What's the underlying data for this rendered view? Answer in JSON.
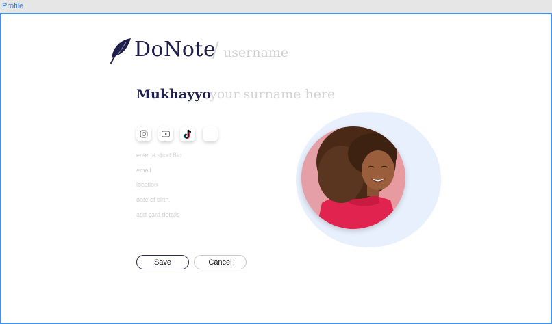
{
  "window": {
    "title": "Profile"
  },
  "brand": {
    "name": "DoNote",
    "separator": "/",
    "username_placeholder": "username"
  },
  "name": {
    "first": "Mukhayyo",
    "surname_placeholder": "your surname here"
  },
  "social_icons": [
    "instagram-icon",
    "youtube-icon",
    "tiktok-icon",
    "blank-icon"
  ],
  "fields": {
    "bio": "enter a short Bio",
    "email": "email",
    "location": "location",
    "dob": "date of birth",
    "card": "add card details"
  },
  "buttons": {
    "save": "Save",
    "cancel": "Cancel"
  },
  "colors": {
    "accent": "#4a90e2",
    "brand_navy": "#1e1f4a",
    "placeholder": "#cfcfcf",
    "halo": "#e8f0fd"
  }
}
